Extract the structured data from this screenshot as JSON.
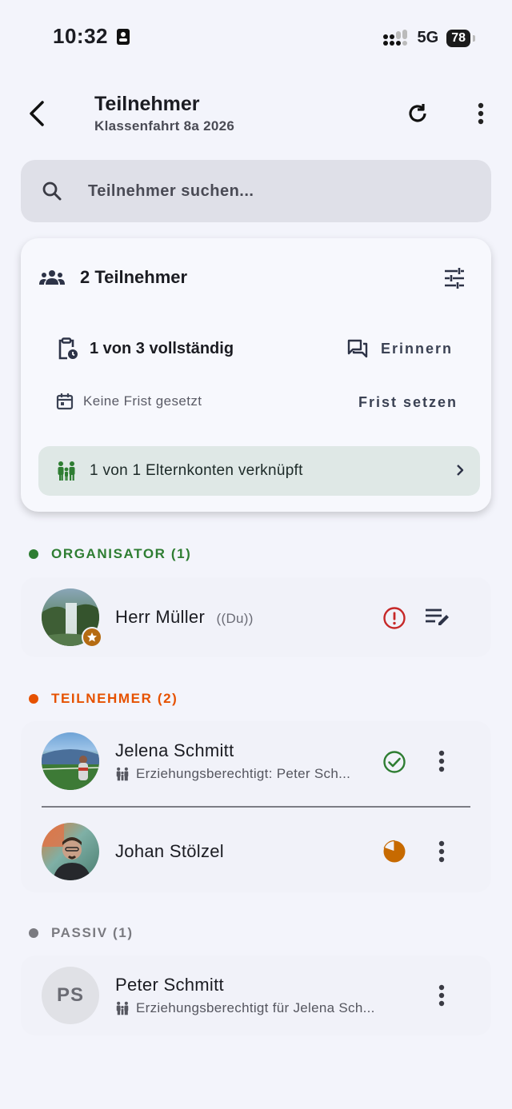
{
  "status_bar": {
    "time": "10:32",
    "network": "5G",
    "battery": "78"
  },
  "app_bar": {
    "title": "Teilnehmer",
    "subtitle": "Klassenfahrt 8a 2026"
  },
  "search": {
    "placeholder": "Teilnehmer suchen..."
  },
  "summary": {
    "count_label": "2 Teilnehmer",
    "completion_label": "1 von 3 vollständig",
    "remind_label": "Erinnern",
    "deadline_label": "Keine Frist gesetzt",
    "set_deadline_label": "Frist setzen",
    "parents_label": "1 von 1 Elternkonten verknüpft"
  },
  "sections": {
    "organizer": {
      "label": "ORGANISATOR (1)",
      "color": "#2e7d32"
    },
    "participants": {
      "label": "TEILNEHMER (2)",
      "color": "#e65100"
    },
    "passive": {
      "label": "PASSIV (1)",
      "color": "#7a7a80"
    }
  },
  "people": {
    "organizer": {
      "name": "Herr Müller",
      "tag": "((Du))",
      "status_icon": "alert-icon"
    },
    "jelena": {
      "name": "Jelena Schmitt",
      "sub": "Erziehungsberechtigt: Peter Sch...",
      "status_icon": "check-circle-icon"
    },
    "johan": {
      "name": "Johan Stölzel",
      "status_icon": "progress-pie-icon",
      "progress": 0.6
    },
    "peter": {
      "name": "Peter Schmitt",
      "initials": "PS",
      "sub": "Erziehungsberechtigt für Jelena Sch..."
    }
  },
  "colors": {
    "accent": "#1b1c22",
    "alert": "#c62828",
    "success": "#2e7d32",
    "progress": "#c76a00",
    "parents_green": "#2e7d32"
  }
}
